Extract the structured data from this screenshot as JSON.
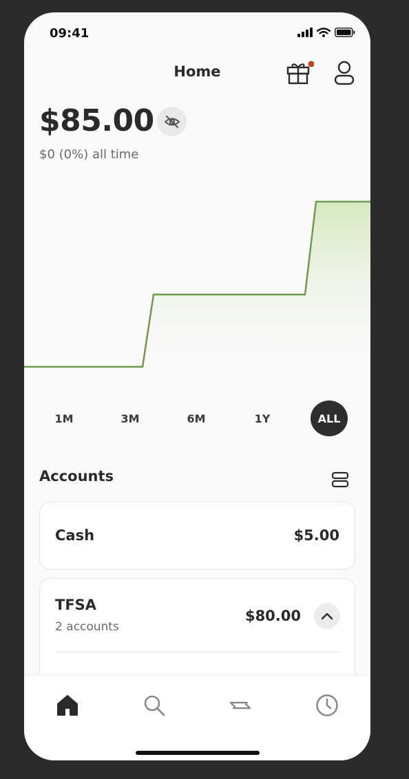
{
  "status_bar": {
    "time": "09:41"
  },
  "header": {
    "title": "Home"
  },
  "portfolio": {
    "balance": "$85.00",
    "all_time_change": "$0 (0%) all time"
  },
  "chart_data": {
    "type": "area",
    "title": "",
    "xlabel": "",
    "ylabel": "",
    "x": [
      0,
      1,
      2,
      3,
      4,
      5,
      6,
      7
    ],
    "values": [
      5,
      5,
      5,
      40,
      40,
      40,
      85,
      85
    ],
    "ylim": [
      0,
      100
    ],
    "grid": false,
    "line_color": "#6e9a4e",
    "fill_color": "#d8ebc4"
  },
  "time_ranges": {
    "options": [
      "1M",
      "3M",
      "6M",
      "1Y",
      "ALL"
    ],
    "selected": "ALL"
  },
  "accounts": {
    "title": "Accounts",
    "cash": {
      "name": "Cash",
      "value": "$5.00"
    },
    "tfsa": {
      "name": "TFSA",
      "subtitle": "2 accounts",
      "value": "$80.00"
    }
  },
  "tab_bar": {
    "items": [
      "home-icon",
      "search-icon",
      "transfer-icon",
      "activity-icon"
    ],
    "active": "home-icon"
  },
  "colors": {
    "accent_green": "#6e9a4e",
    "notification_dot": "#c0441e",
    "dark": "#2e2e2e"
  }
}
